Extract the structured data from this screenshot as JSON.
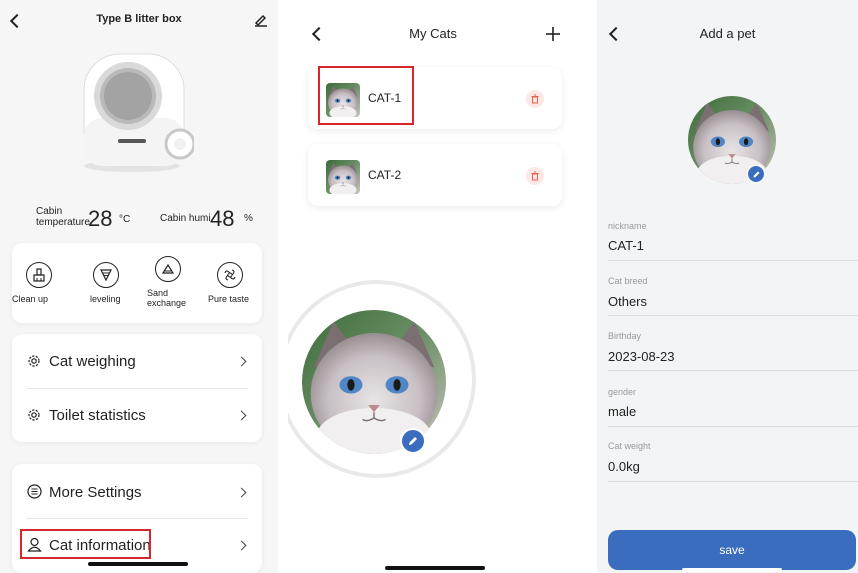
{
  "device": {
    "title": "Type B litter box",
    "temperature": {
      "label_line1": "Cabin",
      "label_line2": "temperature",
      "value": "28",
      "unit": "°C"
    },
    "humidity": {
      "label": "Cabin humi",
      "value": "48",
      "unit": "%"
    },
    "quick_actions": [
      {
        "label": "Clean up",
        "icon": "broom-icon"
      },
      {
        "label": "leveling",
        "icon": "leveling-icon"
      },
      {
        "label_line1": "Sand",
        "label_line2": "exchange",
        "icon": "sand-exchange-icon"
      },
      {
        "label": "Pure taste",
        "icon": "pure-taste-icon"
      }
    ],
    "menu_group_1": [
      {
        "label": "Cat weighing",
        "icon": "gear-icon"
      },
      {
        "label": "Toilet statistics",
        "icon": "gear-icon"
      }
    ],
    "menu_group_2": [
      {
        "label": "More Settings",
        "icon": "list-icon"
      },
      {
        "label": "Cat information",
        "icon": "person-icon"
      }
    ]
  },
  "my_cats": {
    "title": "My Cats",
    "cats": [
      {
        "name": "CAT-1"
      },
      {
        "name": "CAT-2"
      }
    ]
  },
  "add_pet": {
    "title": "Add a pet",
    "fields": [
      {
        "label": "nickname",
        "value": "CAT-1"
      },
      {
        "label": "Cat breed",
        "value": "Others"
      },
      {
        "label": "Birthday",
        "value": "2023-08-23"
      },
      {
        "label": "gender",
        "value": "male"
      },
      {
        "label": "Cat weight",
        "value": "0.0kg"
      }
    ],
    "save_label": "save"
  },
  "colors": {
    "accent_blue": "#3b6dbf",
    "highlight_red": "#d9262b",
    "delete_red": "#e8604f"
  }
}
